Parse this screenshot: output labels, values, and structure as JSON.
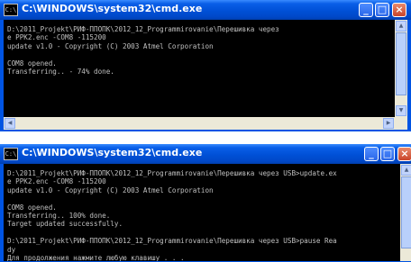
{
  "windows": [
    {
      "title": "C:\\WINDOWS\\system32\\cmd.exe",
      "icon": "cmd-app-icon",
      "controls": {
        "minimize": "_",
        "maximize": "□",
        "close": "×"
      },
      "console_text": "D:\\2011_Projekt\\РИФ-ППОПК\\2012_12_Programmirovanie\\Перешивка через\ne PPK2.enc -COM8 -115200\nupdate v1.0 - Copyright (C) 2003 Atmel Corporation\n\nCOM8 opened.\nTransferring.. - 74% done."
    },
    {
      "title": "C:\\WINDOWS\\system32\\cmd.exe",
      "icon": "cmd-app-icon",
      "controls": {
        "minimize": "_",
        "maximize": "□",
        "close": "×"
      },
      "console_text": "D:\\2011_Projekt\\РИФ-ППОПК\\2012_12_Programmirovanie\\Перешивка через USB>update.ex\ne PPK2.enc -COM8 -115200\nupdate v1.0 - Copyright (C) 2003 Atmel Corporation\n\nCOM8 opened.\nTransferring.. 100% done.\nTarget updated successfully.\n\nD:\\2011_Projekt\\РИФ-ППОПК\\2012_12_Programmirovanie\\Перешивка через USB>pause Rea\ndy\nДля продолжения нажмите любую клавишу . . ."
    }
  ],
  "scroll_arrows": {
    "up": "▲",
    "down": "▼",
    "left": "◀",
    "right": "▶"
  },
  "colors": {
    "titlebar": "#0054e3",
    "console_bg": "#000000",
    "console_fg": "#c0c0c0",
    "close": "#c9452b"
  }
}
